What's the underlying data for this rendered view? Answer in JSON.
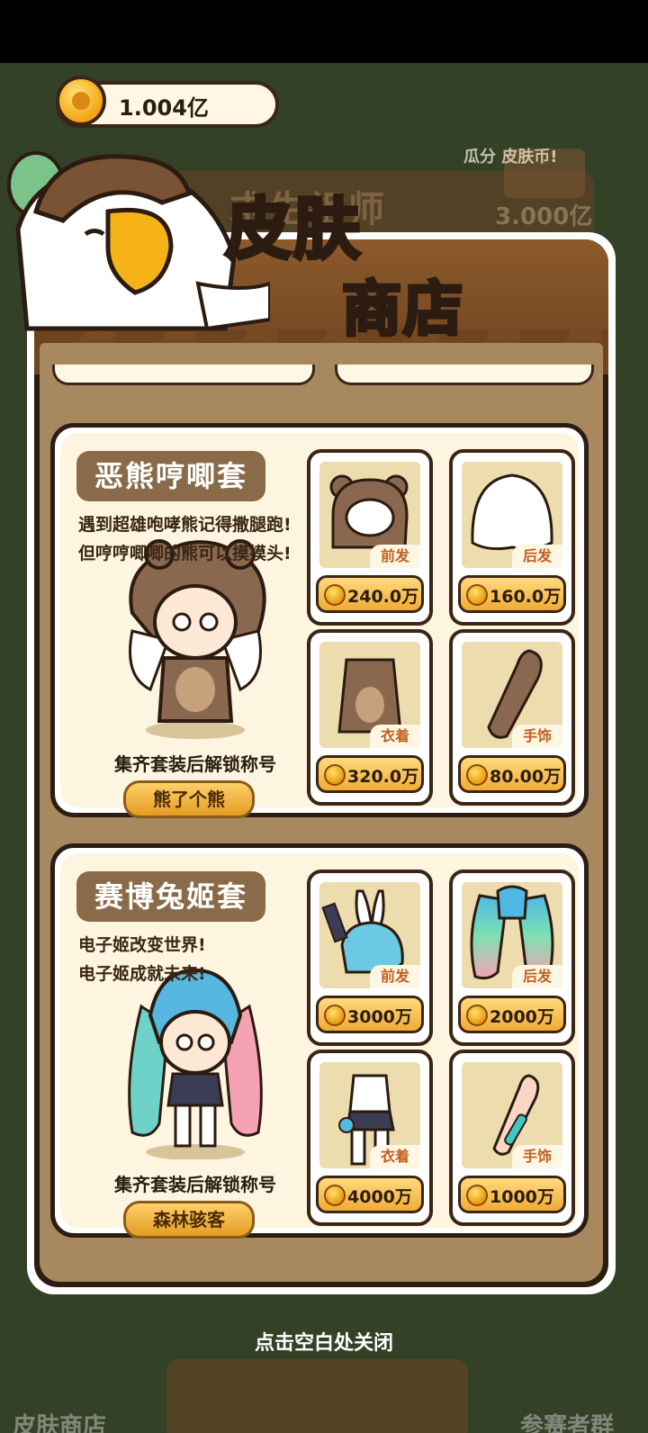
{
  "header": {
    "coin_amount": "1.004亿",
    "bg_title": "求生祖师",
    "bg_side_title": "瓜分   皮肤币!",
    "bg_side_value": "3.000亿"
  },
  "shop": {
    "title_line1": "皮肤",
    "title_line2": "商店"
  },
  "sets": [
    {
      "name": "恶熊哼唧套",
      "description": "遇到超雄咆哮熊记得撒腿跑!\n但哼哼唧唧的熊可以摸摸头!",
      "unlock_text": "集齐套装后解锁称号",
      "reward_title": "熊了个熊",
      "items": [
        {
          "slot": "前发",
          "price": "240.0万",
          "icon": "bear-hood-hair"
        },
        {
          "slot": "后发",
          "price": "160.0万",
          "icon": "white-back-hair"
        },
        {
          "slot": "衣着",
          "price": "320.0万",
          "icon": "bear-costume"
        },
        {
          "slot": "手饰",
          "price": "80.00万",
          "icon": "bear-paw-arm"
        }
      ]
    },
    {
      "name": "赛博兔姬套",
      "description": "电子姬改变世界!\n电子姬成就未来!",
      "unlock_text": "集齐套装后解锁称号",
      "reward_title": "森林骇客",
      "items": [
        {
          "slot": "前发",
          "price": "3000万",
          "icon": "bunny-ear-hair"
        },
        {
          "slot": "后发",
          "price": "2000万",
          "icon": "gradient-twin-tails"
        },
        {
          "slot": "衣着",
          "price": "4000万",
          "icon": "cyber-bunny-suit"
        },
        {
          "slot": "手饰",
          "price": "1000万",
          "icon": "cyber-arm-bracelet"
        }
      ]
    }
  ],
  "footer": {
    "close_hint": "点击空白处关闭",
    "left_label": "皮肤商店",
    "right_label": "参赛者群"
  },
  "colors": {
    "background": "#334126",
    "panel_dark": "#2c1d13",
    "panel_body": "#a8885e",
    "card_fill": "#fdf5e0",
    "title_yellow": "#ffe16b",
    "price_button": "#f0ac34"
  }
}
